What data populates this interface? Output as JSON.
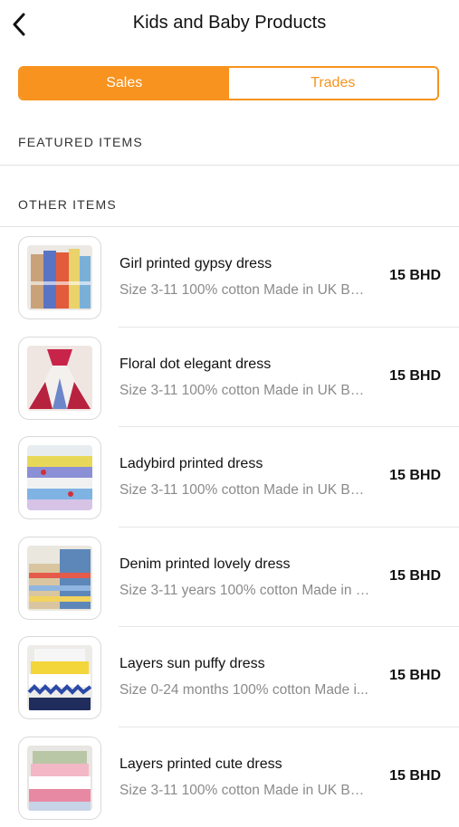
{
  "header": {
    "title": "Kids and Baby Products"
  },
  "tabs": [
    {
      "label": "Sales",
      "active": true
    },
    {
      "label": "Trades",
      "active": false
    }
  ],
  "sections": {
    "featured": "FEATURED ITEMS",
    "other": "OTHER ITEMS"
  },
  "colors": {
    "accent": "#f7931e"
  },
  "items": [
    {
      "title": "Girl printed gypsy dress",
      "description": "Size 3-11 100% cotton Made in UK BD ...",
      "price": "15 BHD"
    },
    {
      "title": "Floral dot elegant dress",
      "description": "Size 3-11 100% cotton Made in UK BD ...",
      "price": "15 BHD"
    },
    {
      "title": "Ladybird printed dress",
      "description": "Size 3-11 100% cotton Made in UK BD ...",
      "price": "15 BHD"
    },
    {
      "title": "Denim printed lovely dress",
      "description": "Size 3-11 years 100% cotton Made in U...",
      "price": "15 BHD"
    },
    {
      "title": "Layers sun puffy dress",
      "description": "Size 0-24 months 100% cotton Made i...",
      "price": "15 BHD"
    },
    {
      "title": "Layers printed cute dress",
      "description": "Size 3-11 100% cotton Made in UK BD ...",
      "price": "15 BHD"
    }
  ]
}
